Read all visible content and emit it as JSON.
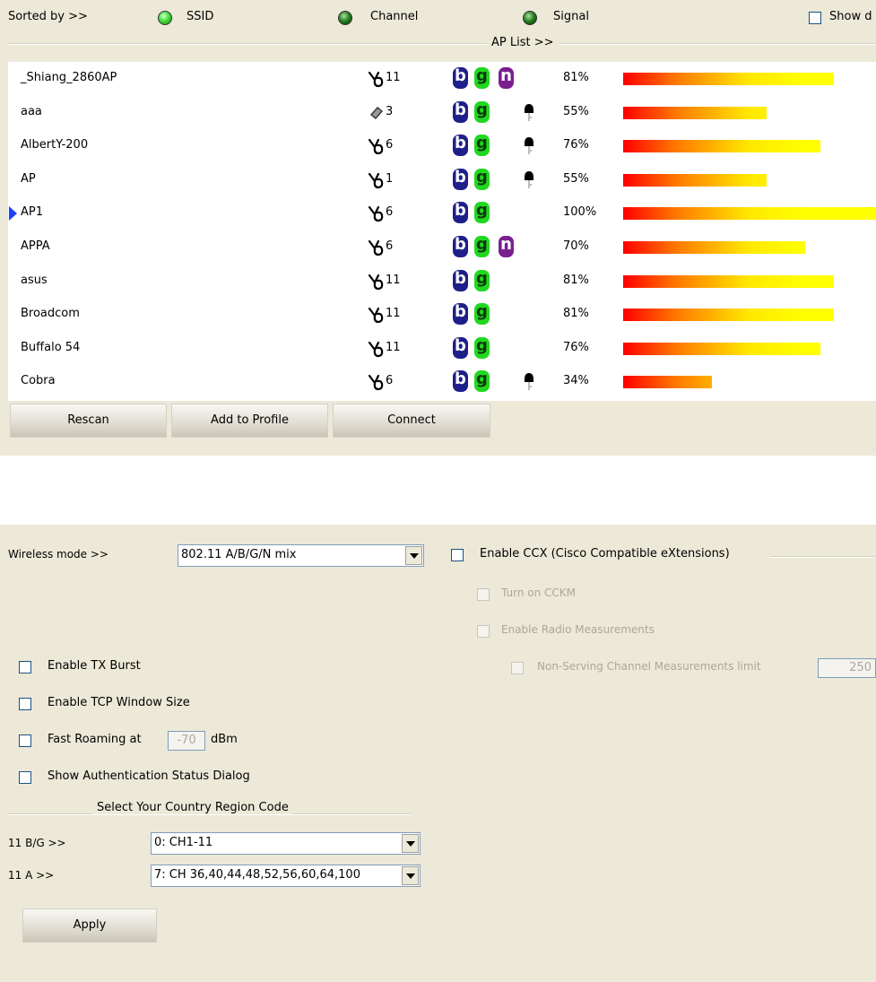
{
  "sort": {
    "label": "Sorted by >>",
    "ssid": "SSID",
    "channel": "Channel",
    "signal": "Signal",
    "show_label": "Show d"
  },
  "ap_list_title": "AP List >>",
  "ap_list": [
    {
      "ssid": "_Shiang_2860AP",
      "channel": "11",
      "modes": [
        "b",
        "g",
        "n"
      ],
      "secure": false,
      "signal": "81%",
      "signal_value": 81,
      "selected": false
    },
    {
      "ssid": "aaa",
      "channel": "3",
      "modes": [
        "b",
        "g"
      ],
      "secure": true,
      "signal": "55%",
      "signal_value": 55,
      "selected": false
    },
    {
      "ssid": "AlbertY-200",
      "channel": "6",
      "modes": [
        "b",
        "g"
      ],
      "secure": true,
      "signal": "76%",
      "signal_value": 76,
      "selected": false
    },
    {
      "ssid": "AP",
      "channel": "1",
      "modes": [
        "b",
        "g"
      ],
      "secure": true,
      "signal": "55%",
      "signal_value": 55,
      "selected": false
    },
    {
      "ssid": "AP1",
      "channel": "6",
      "modes": [
        "b",
        "g"
      ],
      "secure": false,
      "signal": "100%",
      "signal_value": 100,
      "selected": true
    },
    {
      "ssid": "APPA",
      "channel": "6",
      "modes": [
        "b",
        "g",
        "n"
      ],
      "secure": false,
      "signal": "70%",
      "signal_value": 70,
      "selected": false
    },
    {
      "ssid": "asus",
      "channel": "11",
      "modes": [
        "b",
        "g"
      ],
      "secure": false,
      "signal": "81%",
      "signal_value": 81,
      "selected": false
    },
    {
      "ssid": "Broadcom",
      "channel": "11",
      "modes": [
        "b",
        "g"
      ],
      "secure": false,
      "signal": "81%",
      "signal_value": 81,
      "selected": false
    },
    {
      "ssid": "Buffalo 54",
      "channel": "11",
      "modes": [
        "b",
        "g"
      ],
      "secure": false,
      "signal": "76%",
      "signal_value": 76,
      "selected": false
    },
    {
      "ssid": "Cobra",
      "channel": "6",
      "modes": [
        "b",
        "g"
      ],
      "secure": true,
      "signal": "34%",
      "signal_value": 34,
      "selected": false
    }
  ],
  "buttons": {
    "rescan": "Rescan",
    "add_to_profile": "Add to Profile",
    "connect": "Connect",
    "apply": "Apply"
  },
  "advanced": {
    "wireless_mode_label": "Wireless mode >>",
    "wireless_mode_value": "802.11 A/B/G/N mix",
    "enable_ccx": "Enable CCX (Cisco Compatible eXtensions)",
    "turn_on_cckm": "Turn on CCKM",
    "enable_radio_measurements": "Enable Radio Measurements",
    "non_serving_limit": "Non-Serving Channel Measurements limit",
    "non_serving_value": "250",
    "enable_tx_burst": "Enable TX Burst",
    "enable_tcp_window": "Enable TCP Window Size",
    "fast_roaming": "Fast Roaming at",
    "fast_roaming_value": "-70",
    "fast_roaming_unit": "dBm",
    "show_auth_dialog": "Show Authentication Status Dialog",
    "country_region_title": "Select Your Country Region Code",
    "bg_label": "11 B/G >>",
    "bg_value": "0: CH1-11",
    "a_label": "11 A >>",
    "a_value": "7: CH 36,40,44,48,52,56,60,64,100"
  },
  "colors": {
    "panel_bg": "#ece9d8",
    "mode_b": "#1f1f8a",
    "mode_g": "#21d821",
    "mode_n": "#7b1f8f",
    "signal_start": "#ff0000",
    "signal_end": "#ffff00"
  },
  "icons": {
    "channel": "channel-antenna-icon",
    "channel_alt": "channel-card-icon",
    "secure": "key-icon",
    "selected": "selection-arrow-icon"
  }
}
